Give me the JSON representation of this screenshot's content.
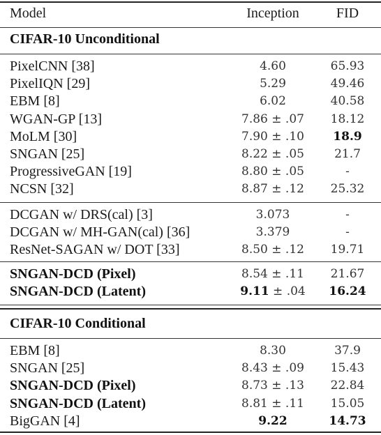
{
  "header": {
    "model": "Model",
    "inception": "Inception",
    "fid": "FID"
  },
  "sections": [
    {
      "title": "CIFAR-10 Unconditional",
      "groups": [
        [
          {
            "model": "PixelCNN [38]",
            "inception": "4.60",
            "fid": "65.93"
          },
          {
            "model": "PixelIQN [29]",
            "inception": "5.29",
            "fid": "49.46"
          },
          {
            "model": "EBM [8]",
            "inception": "6.02",
            "fid": "40.58"
          },
          {
            "model": "WGAN-GP [13]",
            "inception": "7.86 ± .07",
            "fid": "18.12"
          },
          {
            "model": "MoLM [30]",
            "inception": "7.90 ± .10",
            "fid": "18.9",
            "fid_bold": true
          },
          {
            "model": "SNGAN [25]",
            "inception": "8.22 ± .05",
            "fid": "21.7"
          },
          {
            "model": "ProgressiveGAN [19]",
            "inception": "8.80 ± .05",
            "fid": "-"
          },
          {
            "model": "NCSN [32]",
            "inception": "8.87 ± .12",
            "fid": "25.32"
          }
        ],
        [
          {
            "model": "DCGAN w/ DRS(cal) [3]",
            "inception": "3.073",
            "fid": "-"
          },
          {
            "model": "DCGAN w/ MH-GAN(cal) [36]",
            "inception": "3.379",
            "fid": "-"
          },
          {
            "model": "ResNet-SAGAN w/ DOT [33]",
            "inception": "8.50 ± .12",
            "fid": "19.71"
          }
        ],
        [
          {
            "model": "SNGAN-DCD (Pixel)",
            "model_bold": true,
            "inception": "8.54 ± .11",
            "fid": "21.67"
          },
          {
            "model": "SNGAN-DCD (Latent)",
            "model_bold": true,
            "inception": "9.11 ± .04",
            "inception_bold_part": "9.11",
            "inception_rest": " ± .04",
            "fid": "16.24",
            "fid_bold": true
          }
        ]
      ]
    },
    {
      "title": "CIFAR-10 Conditional",
      "groups": [
        [
          {
            "model": "EBM [8]",
            "inception": "8.30",
            "fid": "37.9"
          },
          {
            "model": "SNGAN [25]",
            "inception": "8.43 ± .09",
            "fid": "15.43"
          },
          {
            "model": "SNGAN-DCD (Pixel)",
            "model_bold": true,
            "inception": "8.73 ± .13",
            "fid": "22.84"
          },
          {
            "model": "SNGAN-DCD (Latent)",
            "model_bold": true,
            "inception": "8.81 ± .11",
            "fid": "15.05"
          },
          {
            "model": "BigGAN [4]",
            "inception": "9.22",
            "inception_bold": true,
            "fid": "14.73",
            "fid_bold": true
          }
        ]
      ]
    }
  ]
}
